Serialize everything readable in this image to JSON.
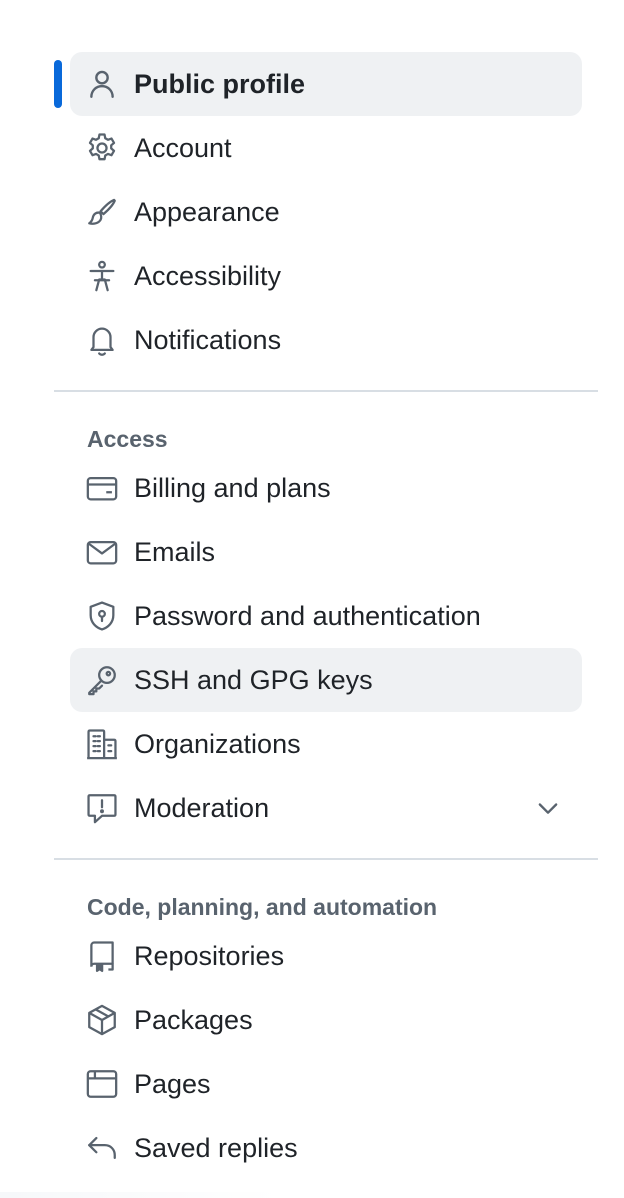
{
  "sidebar": {
    "items": [
      {
        "label": "Public profile",
        "icon": "person-icon"
      },
      {
        "label": "Account",
        "icon": "gear-icon"
      },
      {
        "label": "Appearance",
        "icon": "paintbrush-icon"
      },
      {
        "label": "Accessibility",
        "icon": "accessibility-icon"
      },
      {
        "label": "Notifications",
        "icon": "bell-icon"
      }
    ],
    "selected": "Public profile",
    "groups": [
      {
        "heading": "Access",
        "items": [
          {
            "label": "Billing and plans",
            "icon": "credit-card-icon"
          },
          {
            "label": "Emails",
            "icon": "mail-icon"
          },
          {
            "label": "Password and authentication",
            "icon": "shield-lock-icon"
          },
          {
            "label": "SSH and GPG keys",
            "icon": "key-icon"
          },
          {
            "label": "Organizations",
            "icon": "organization-icon"
          },
          {
            "label": "Moderation",
            "icon": "report-icon",
            "expandable": true
          }
        ]
      },
      {
        "heading": "Code, planning, and automation",
        "items": [
          {
            "label": "Repositories",
            "icon": "repo-icon"
          },
          {
            "label": "Packages",
            "icon": "package-icon"
          },
          {
            "label": "Pages",
            "icon": "browser-icon"
          },
          {
            "label": "Saved replies",
            "icon": "reply-icon"
          }
        ]
      }
    ]
  },
  "colors": {
    "accent": "#0969da",
    "text": "#1f2328",
    "muted": "#59636e",
    "selected_bg": "#eff1f3",
    "divider": "#d8dee4"
  }
}
